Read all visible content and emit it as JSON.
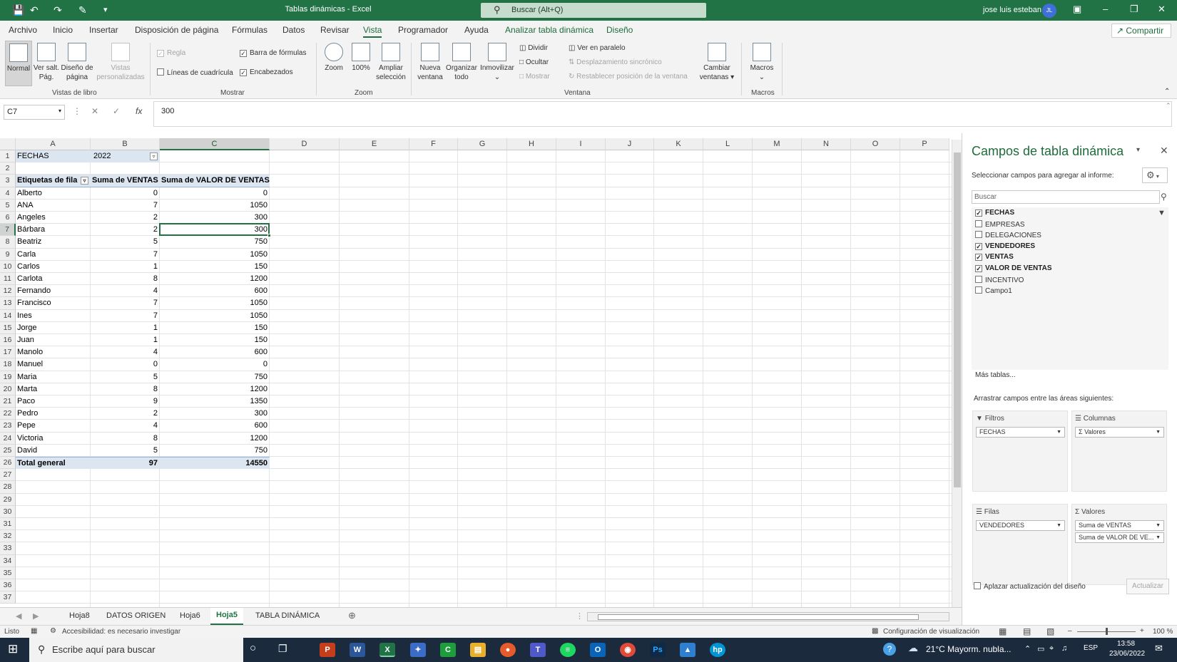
{
  "titlebar": {
    "title": "Tablas dinámicas  -  Excel",
    "search": "Buscar (Alt+Q)",
    "user": "jose luis esteban",
    "initials": "JL"
  },
  "menu": {
    "tabs": [
      "Archivo",
      "Inicio",
      "Insertar",
      "Disposición de página",
      "Fórmulas",
      "Datos",
      "Revisar",
      "Vista",
      "Programador",
      "Ayuda",
      "Analizar tabla dinámica",
      "Diseño"
    ],
    "active": "Vista",
    "share": "Compartir"
  },
  "ribbon": {
    "normal": "Normal",
    "salt": "Ver salt. Pág.",
    "diseno": "Diseño de página",
    "vistas": "Vistas personalizadas",
    "grp_vistas": "Vistas de libro",
    "regla": "Regla",
    "lineas": "Líneas de cuadrícula",
    "barra": "Barra de fórmulas",
    "encabezados": "Encabezados",
    "grp_mostrar": "Mostrar",
    "zoom": "Zoom",
    "zoom100": "100%",
    "ampliar": "Ampliar selección",
    "grp_zoom": "Zoom",
    "nueva": "Nueva ventana",
    "organizar": "Organizar todo",
    "inmovilizar": "Inmovilizar",
    "dividir": "Dividir",
    "ocultar": "Ocultar",
    "mostrar": "Mostrar",
    "paralelo": "Ver en paralelo",
    "desplaz": "Desplazamiento sincrónico",
    "restablecer": "Restablecer posición de la ventana",
    "cambiar": "Cambiar ventanas",
    "grp_ventana": "Ventana",
    "macros": "Macros",
    "grp_macros": "Macros"
  },
  "formula": {
    "namebox": "C7",
    "value": "300"
  },
  "columns": [
    "A",
    "B",
    "C",
    "D",
    "E",
    "F",
    "G",
    "H",
    "I",
    "J",
    "K",
    "L",
    "M",
    "N",
    "O",
    "P"
  ],
  "pivot": {
    "filter_label": "FECHAS",
    "filter_value": "2022",
    "headers": [
      "Etiquetas de fila",
      "Suma de VENTAS",
      "Suma de VALOR DE VENTAS"
    ],
    "rows": [
      [
        "Alberto",
        "0",
        "0"
      ],
      [
        "ANA",
        "7",
        "1050"
      ],
      [
        "Angeles",
        "2",
        "300"
      ],
      [
        "Bárbara",
        "2",
        "300"
      ],
      [
        "Beatriz",
        "5",
        "750"
      ],
      [
        "Carla",
        "7",
        "1050"
      ],
      [
        "Carlos",
        "1",
        "150"
      ],
      [
        "Carlota",
        "8",
        "1200"
      ],
      [
        "Fernando",
        "4",
        "600"
      ],
      [
        "Francisco",
        "7",
        "1050"
      ],
      [
        "Ines",
        "7",
        "1050"
      ],
      [
        "Jorge",
        "1",
        "150"
      ],
      [
        "Juan",
        "1",
        "150"
      ],
      [
        "Manolo",
        "4",
        "600"
      ],
      [
        "Manuel",
        "0",
        "0"
      ],
      [
        "Maria",
        "5",
        "750"
      ],
      [
        "Marta",
        "8",
        "1200"
      ],
      [
        "Paco",
        "9",
        "1350"
      ],
      [
        "Pedro",
        "2",
        "300"
      ],
      [
        "Pepe",
        "4",
        "600"
      ],
      [
        "Victoria",
        "8",
        "1200"
      ],
      [
        "David",
        "5",
        "750"
      ]
    ],
    "total": [
      "Total general",
      "97",
      "14550"
    ]
  },
  "sheets": {
    "tabs": [
      "Hoja8",
      "DATOS ORIGEN",
      "Hoja6",
      "Hoja5",
      "TABLA DINÁMICA"
    ],
    "active": "Hoja5"
  },
  "status": {
    "ready": "Listo",
    "access": "Accesibilidad: es necesario investigar",
    "config": "Configuración de visualización",
    "zoom": "100 %"
  },
  "panel": {
    "title": "Campos de tabla dinámica",
    "subtitle": "Seleccionar campos para agregar al informe:",
    "search_placeholder": "Buscar",
    "fields": [
      {
        "name": "FECHAS",
        "checked": true
      },
      {
        "name": "EMPRESAS",
        "checked": false
      },
      {
        "name": "DELEGACIONES",
        "checked": false
      },
      {
        "name": "VENDEDORES",
        "checked": true
      },
      {
        "name": "VENTAS",
        "checked": true
      },
      {
        "name": "VALOR DE VENTAS",
        "checked": true
      },
      {
        "name": "INCENTIVO",
        "checked": false
      },
      {
        "name": "Campo1",
        "checked": false
      }
    ],
    "more": "Más tablas...",
    "drag": "Arrastrar campos entre las áreas siguientes:",
    "areas": {
      "filtros": {
        "label": "Filtros",
        "items": [
          "FECHAS"
        ]
      },
      "columnas": {
        "label": "Columnas",
        "items": [
          "Σ  Valores"
        ]
      },
      "filas": {
        "label": "Filas",
        "items": [
          "VENDEDORES"
        ]
      },
      "valores": {
        "label": "Valores",
        "items": [
          "Suma de VENTAS",
          "Suma de VALOR DE VE..."
        ]
      }
    },
    "defer": "Aplazar actualización del diseño",
    "update": "Actualizar"
  },
  "taskbar": {
    "search": "Escribe aquí para buscar",
    "weather": "21°C  Mayorm. nubla...",
    "lang": "ESP",
    "time": "13:58",
    "date": "23/06/2022"
  }
}
